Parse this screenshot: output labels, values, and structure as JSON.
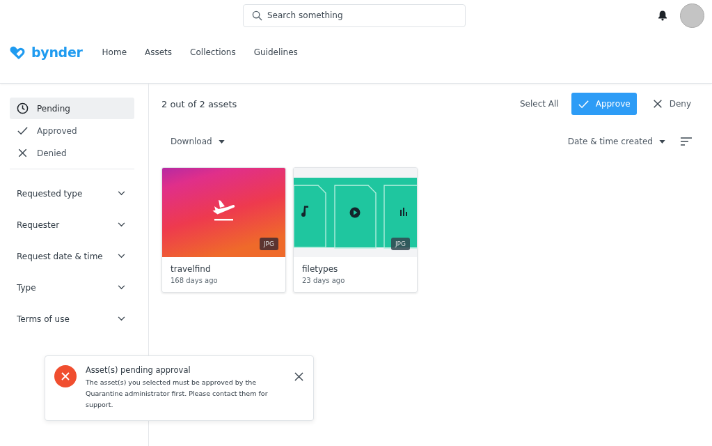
{
  "search": {
    "placeholder": "Search something"
  },
  "brand": "bynder",
  "nav": [
    {
      "label": "Home"
    },
    {
      "label": "Assets"
    },
    {
      "label": "Collections"
    },
    {
      "label": "Guidelines"
    }
  ],
  "status_filters": [
    {
      "label": "Pending",
      "kind": "clock",
      "selected": true
    },
    {
      "label": "Approved",
      "kind": "check",
      "selected": false
    },
    {
      "label": "Denied",
      "kind": "cross",
      "selected": false
    }
  ],
  "filters": [
    {
      "label": "Requested type",
      "expanded": false
    },
    {
      "label": "Requester",
      "expanded": false
    },
    {
      "label": "Request date & time",
      "expanded": false
    },
    {
      "label": "Type",
      "expanded": false
    },
    {
      "label": "Terms of use",
      "expanded": false
    }
  ],
  "count": "2 out of 2 assets",
  "actions": {
    "select_all": "Select All",
    "approve": "Approve",
    "deny": "Deny"
  },
  "download": "Download",
  "sort": "Date & time created",
  "assets": [
    {
      "name": "travelfind",
      "age": "168 days ago",
      "badge": "JPG",
      "kind": "picture"
    },
    {
      "name": "filetypes",
      "age": "23 days ago",
      "badge": "JPG",
      "kind": "files"
    }
  ],
  "toast": {
    "title": "Asset(s) pending approval",
    "message": "The asset(s) you selected must be approved by the Quarantine administrator first. Please contact them for support."
  }
}
